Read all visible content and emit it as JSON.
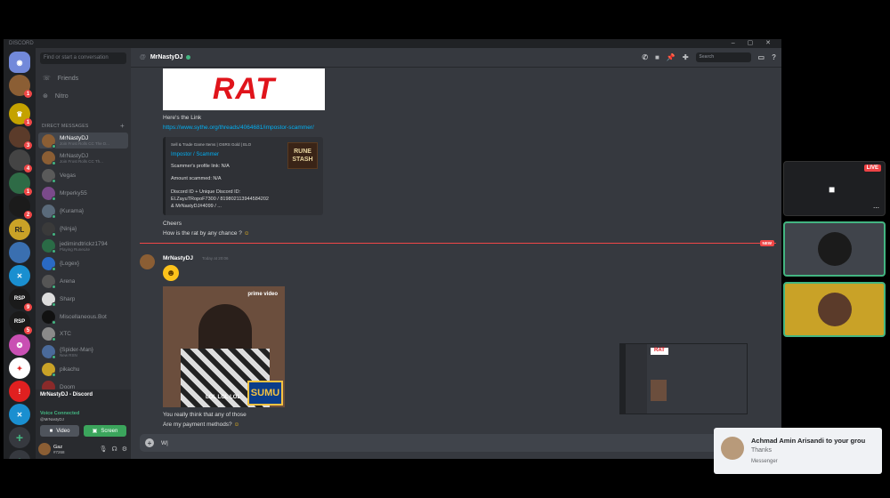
{
  "app": {
    "title": "DISCORD",
    "window_buttons": "–  ▢  ✕"
  },
  "dm": {
    "search_placeholder": "Find or start a conversation",
    "friends": "Friends",
    "nitro": "Nitro",
    "section": "DIRECT MESSAGES",
    "items": [
      {
        "name": "MrNastyDJ",
        "sub": "Join Frost Rolls CC The D..."
      },
      {
        "name": "MrNastyDJ",
        "sub": "Join Frost Rolls CC Th..."
      },
      {
        "name": "Vegas",
        "sub": ""
      },
      {
        "name": "Mrperky55",
        "sub": ""
      },
      {
        "name": "{Kurama}",
        "sub": ""
      },
      {
        "name": "{Ninja}",
        "sub": ""
      },
      {
        "name": "jedimindtrickz1794",
        "sub": "Playing RuneLite"
      },
      {
        "name": "{Logex}",
        "sub": ""
      },
      {
        "name": "Arena",
        "sub": ""
      },
      {
        "name": "Sharp",
        "sub": ""
      },
      {
        "name": "Miscellaneous.Bot",
        "sub": ""
      },
      {
        "name": "XTC",
        "sub": ""
      },
      {
        "name": "{Spider-Man}",
        "sub": "New RSN"
      },
      {
        "name": "pikachu",
        "sub": ""
      },
      {
        "name": "Doom",
        "sub": ""
      }
    ]
  },
  "voice": {
    "call_title": "MrNastyDJ - Discord",
    "connected": "Voice Connected",
    "sub": "@MrNastyDJ",
    "video": "Video",
    "screen": "Screen",
    "user": "Gaz",
    "tag": "#7268"
  },
  "channel": {
    "name": "MrNastyDJ",
    "search_placeholder": "Search"
  },
  "messages": {
    "rat_image_text": "RAT",
    "heres_link": "Here's the Link",
    "url": "https://www.sythe.org/threads/4064681/impostor-scammer/",
    "embed": {
      "site": "Sell & Trade Game Items | OSRS Gold | ELO",
      "title": "Impostor / Scammer",
      "profile": "Scammer's profile link: N/A",
      "amount": "Amount scammed: N/A",
      "discord1": "Discord ID + Unique Discord ID:",
      "discord2": "El.ZayuTRopoF7300 / 819802113944584202",
      "discord3": "& MrNastyDJ#4099 / ...",
      "thumb": "RUNE STASH"
    },
    "cheers": "Cheers",
    "question": "How is the rat by any chance ?",
    "new_label": "NEW",
    "author": "MrNastyDJ",
    "time": "Today at 20:06",
    "gif_brand": "prime video",
    "gif_lol": "LOL LOL LOL",
    "gif_logo": "SUMU",
    "reply1": "You really think that any of those",
    "reply2": "Are my payment methods?"
  },
  "input": {
    "value": "W|"
  },
  "overlay": {
    "live": "LIVE"
  },
  "toast": {
    "title": "Achmad Amin Arisandi to your grou",
    "body": "Thanks",
    "source": "Messenger"
  }
}
